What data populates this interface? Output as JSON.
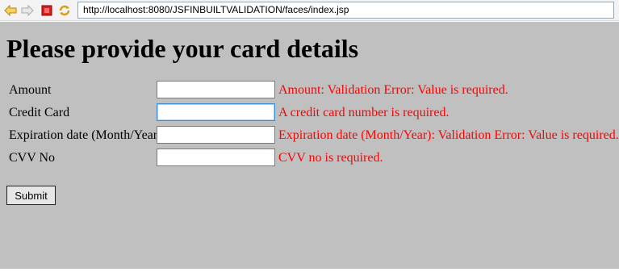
{
  "browser": {
    "url": "http://localhost:8080/JSFINBUILTVALIDATION/faces/index.jsp",
    "icons": [
      "back-icon",
      "forward-icon",
      "stop-icon",
      "refresh-icon"
    ]
  },
  "page": {
    "heading": "Please provide your card details",
    "fields": [
      {
        "label": "Amount",
        "value": "",
        "error": "Amount: Validation Error: Value is required."
      },
      {
        "label": "Credit Card",
        "value": "",
        "error": "A credit card number is required."
      },
      {
        "label": "Expiration date (Month/Year)",
        "value": "",
        "error": "Expiration date (Month/Year): Validation Error: Value is required."
      },
      {
        "label": "CVV No",
        "value": "",
        "error": "CVV no is required."
      }
    ],
    "submit_label": "Submit"
  },
  "colors": {
    "page_background": "#c0c0c0",
    "error_text": "#ff0000"
  }
}
